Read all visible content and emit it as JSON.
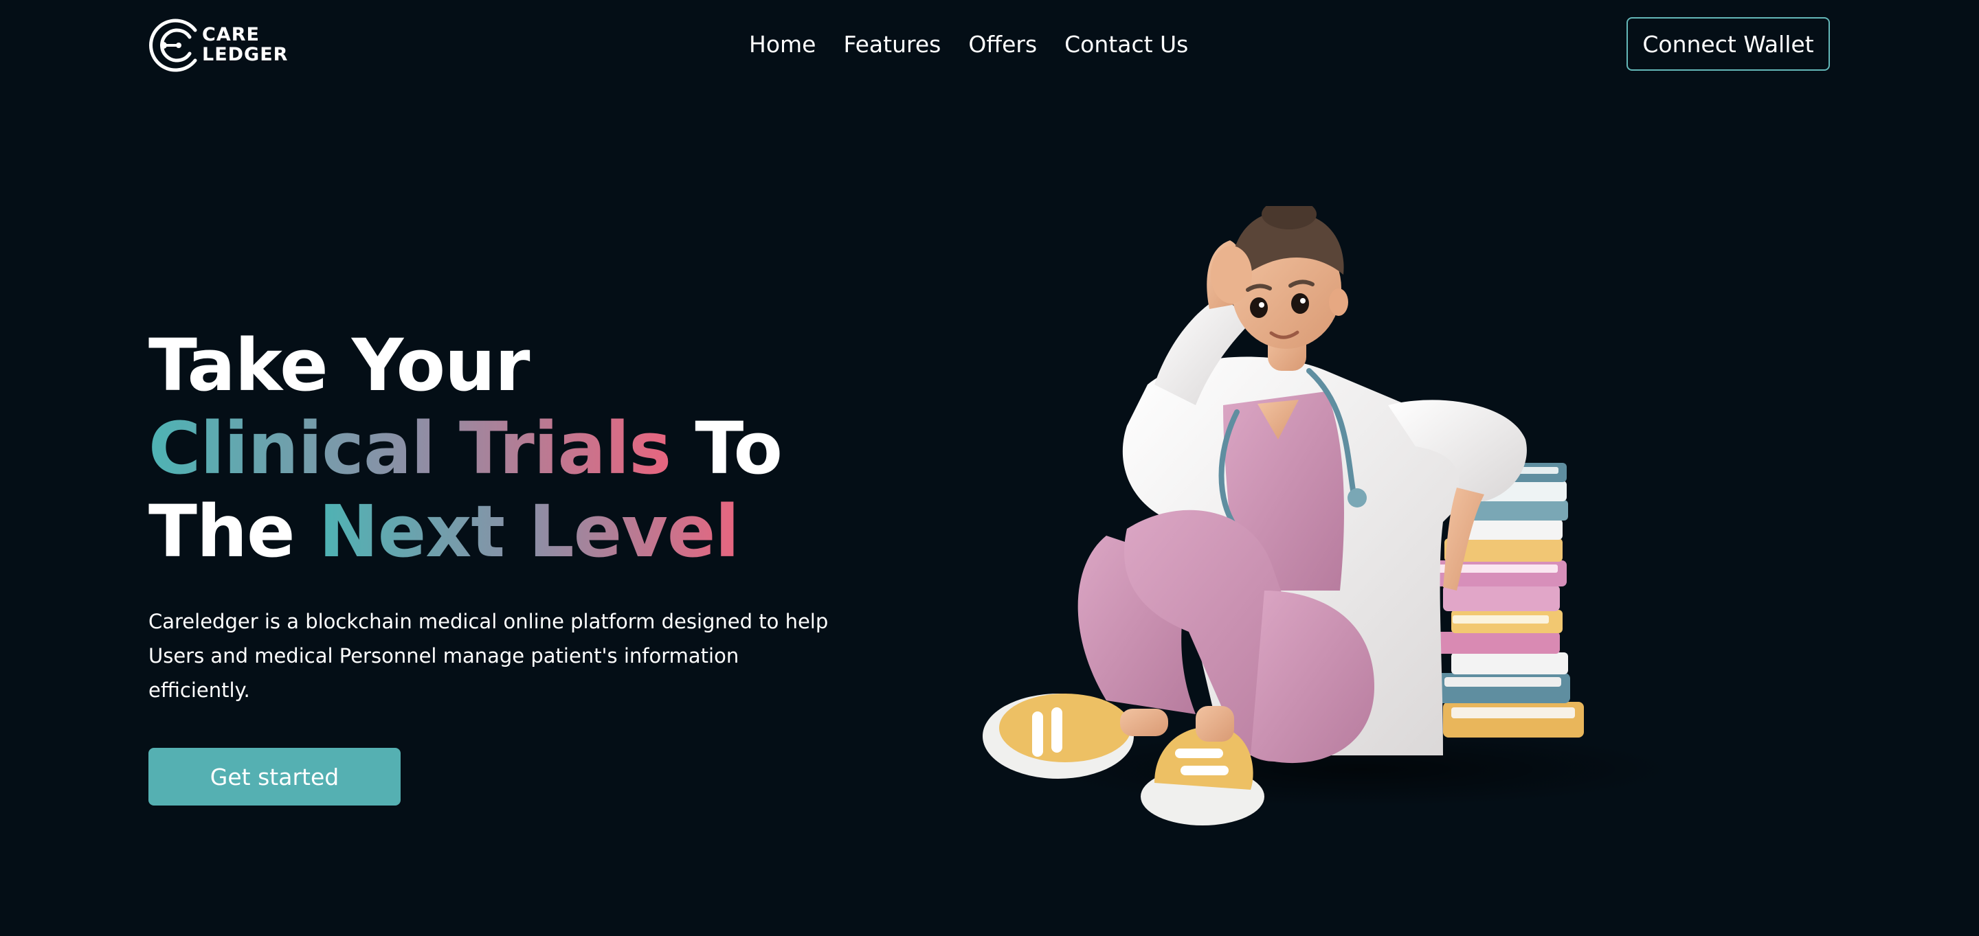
{
  "brand": {
    "name_line1": "CARE",
    "name_line2": "LEDGER"
  },
  "nav": {
    "links": [
      {
        "label": "Home"
      },
      {
        "label": "Features"
      },
      {
        "label": "Offers"
      },
      {
        "label": "Contact Us"
      }
    ],
    "connect_wallet_label": "Connect Wallet"
  },
  "hero": {
    "line1": "Take Your",
    "line2_gradient": "Clinical Trials",
    "line2_plain": " To",
    "line3_plain": "The ",
    "line3_gradient": "Next Level",
    "description": "Careledger is a blockchain medical online platform designed to help Users and medical Personnel manage patient's information efficiently.",
    "cta_label": "Get started"
  },
  "colors": {
    "background": "#040e16",
    "accent_teal": "#55b0b2",
    "gradient_start": "#4eb3b4",
    "gradient_mid": "#8f8ea5",
    "gradient_end": "#e8657f",
    "wallet_border": "#64b7b8"
  },
  "icons": {
    "logo": "careledger-logo-icon",
    "illustration": "doctor-with-books-illustration"
  }
}
